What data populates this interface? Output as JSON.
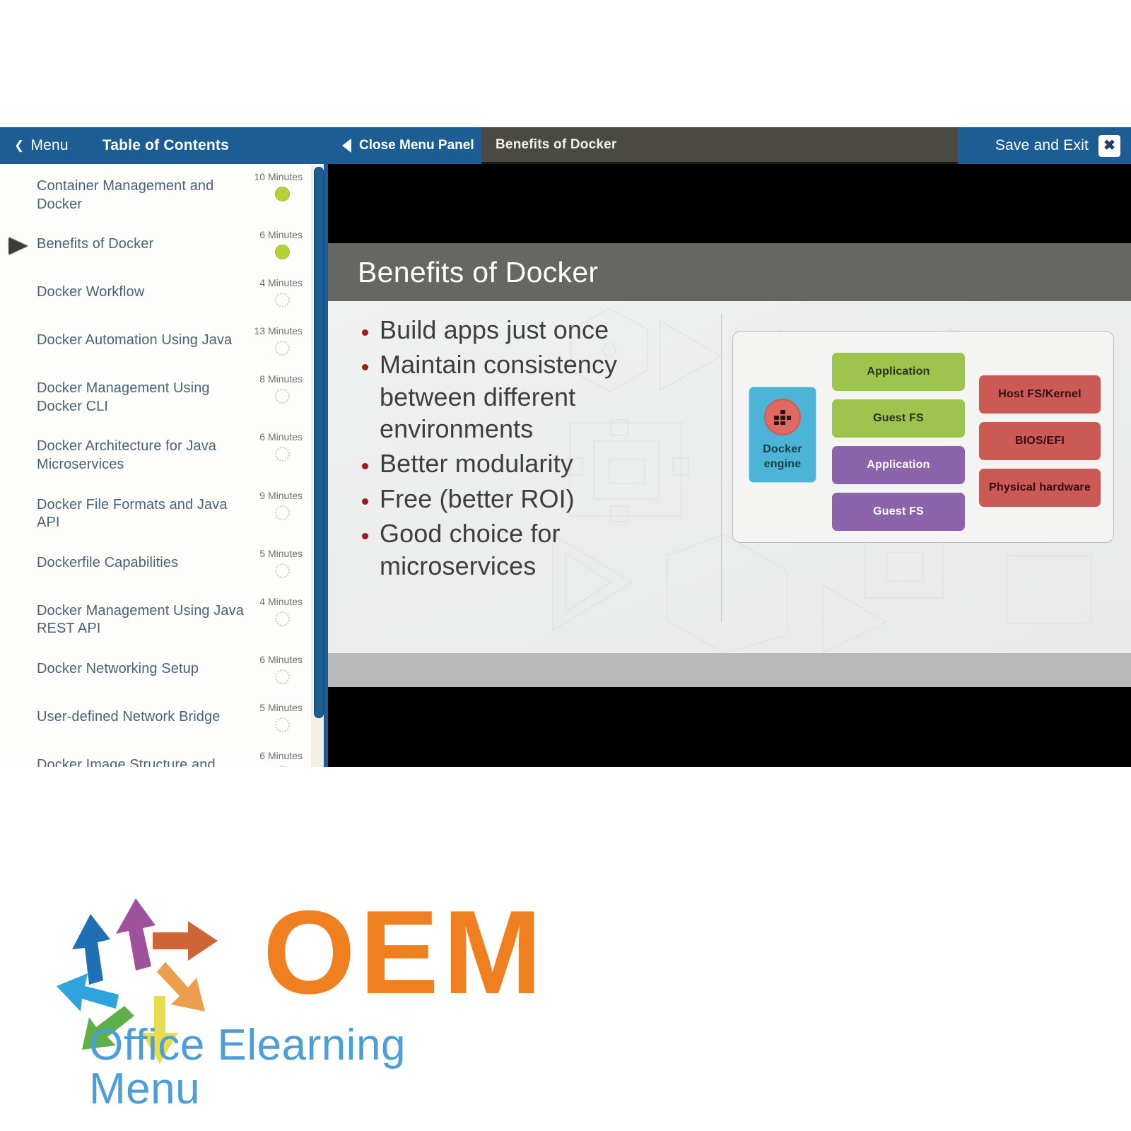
{
  "topbar": {
    "menu_label": "Menu",
    "back_chevron": "chevron-left-icon",
    "toc_label": "Table of Contents",
    "close_panel_label": "Close Menu Panel",
    "slide_tab_label": "Benefits of Docker",
    "save_exit_label": "Save and Exit",
    "close_glyph": "✖",
    "accent_blue": "#1c5d93",
    "tab_dark": "#4a4a42"
  },
  "sidebar": {
    "items": [
      {
        "title": "Container Management and Docker",
        "duration": "10 Minutes",
        "status": "done",
        "current": false
      },
      {
        "title": "Benefits of Docker",
        "duration": "6 Minutes",
        "status": "done",
        "current": true
      },
      {
        "title": "Docker Workflow",
        "duration": "4 Minutes",
        "status": "todo",
        "current": false
      },
      {
        "title": "Docker Automation Using Java",
        "duration": "13 Minutes",
        "status": "todo",
        "current": false
      },
      {
        "title": "Docker Management Using Docker CLI",
        "duration": "8 Minutes",
        "status": "todo",
        "current": false
      },
      {
        "title": "Docker Architecture for Java Microservices",
        "duration": "6 Minutes",
        "status": "todo",
        "current": false
      },
      {
        "title": "Docker File Formats and Java API",
        "duration": "9 Minutes",
        "status": "todo",
        "current": false
      },
      {
        "title": "Dockerfile Capabilities",
        "duration": "5 Minutes",
        "status": "todo",
        "current": false
      },
      {
        "title": "Docker Management Using Java REST API",
        "duration": "4 Minutes",
        "status": "todo",
        "current": false
      },
      {
        "title": "Docker Networking Setup",
        "duration": "6 Minutes",
        "status": "todo",
        "current": false
      },
      {
        "title": "User-defined Network Bridge",
        "duration": "5 Minutes",
        "status": "todo",
        "current": false
      },
      {
        "title": "Docker Image Structure and Layout",
        "duration": "6 Minutes",
        "status": "todo",
        "current": false
      }
    ],
    "done_color": "#b3d335",
    "text_color": "#4b6275"
  },
  "slide": {
    "title": "Benefits of Docker",
    "bullets": [
      "Build apps just once",
      "Maintain consistency between different environments",
      "Better modularity",
      "Free (better ROI)",
      "Good choice for microservices"
    ],
    "bullet_color": "#9e1b1b",
    "title_bar_color": "#666662",
    "diagram": {
      "engine_label_line1": "Docker",
      "engine_label_line2": "engine",
      "engine_color": "#4cb4d6",
      "boxes": [
        {
          "label": "Application",
          "color": "green"
        },
        {
          "label": "Guest FS",
          "color": "green"
        },
        {
          "label": "Application",
          "color": "purple"
        },
        {
          "label": "Guest FS",
          "color": "purple"
        },
        {
          "label": "Host FS/Kernel",
          "color": "red"
        },
        {
          "label": "BIOS/EFI",
          "color": "red"
        },
        {
          "label": "Physical hardware",
          "color": "red"
        }
      ],
      "green_color": "#9dc44c",
      "purple_color": "#8b64ab",
      "red_color": "#cb5a57"
    }
  },
  "logo": {
    "wordmark": "OEM",
    "tagline": "Office Elearning Menu",
    "wordmark_color": "#ef7f1f",
    "tagline_color": "#4d9ed6"
  }
}
